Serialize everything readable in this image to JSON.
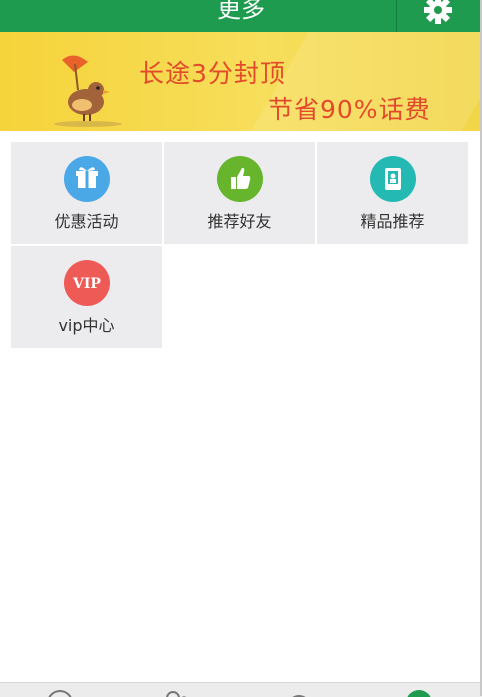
{
  "header": {
    "title": "更多",
    "settings_icon": "gear-icon"
  },
  "banner": {
    "line1": "长途3分封顶",
    "line2": "节省90%话费"
  },
  "menu": [
    {
      "label": "优惠活动",
      "icon": "gift-icon",
      "color": "#4aa8e6"
    },
    {
      "label": "推荐好友",
      "icon": "thumbs-up-icon",
      "color": "#66b52c"
    },
    {
      "label": "精品推荐",
      "icon": "app-icon",
      "color": "#25b9b3"
    },
    {
      "label": "vip中心",
      "icon": "vip-icon",
      "color": "#ee5a55"
    }
  ],
  "bottom_nav": [
    {
      "icon": "dialpad-icon"
    },
    {
      "icon": "contacts-icon"
    },
    {
      "icon": "message-icon"
    },
    {
      "icon": "more-icon",
      "active": true
    }
  ],
  "colors": {
    "primary": "#1f9b4f",
    "tile_bg": "#ececef",
    "banner_text": "#e24a2b"
  }
}
